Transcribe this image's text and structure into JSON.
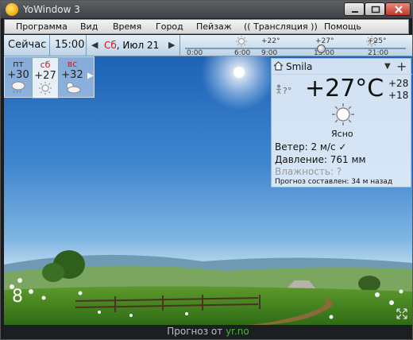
{
  "window": {
    "title": "YoWindow 3"
  },
  "menu": [
    "Программа",
    "Вид",
    "Время",
    "Город",
    "Пейзаж",
    "(( Трансляция ))",
    "Помощь"
  ],
  "timebar": {
    "now_label": "Сейчас",
    "time": "15:00",
    "date_dow": "Сб",
    "date_rest": ", Июл 21",
    "ticks": [
      "0:00",
      "6:00",
      "9:00",
      "15:00",
      "21:00"
    ],
    "temps": [
      "+22°",
      "+27°",
      "+25°"
    ]
  },
  "forecast": {
    "days": [
      {
        "name": "пт",
        "temp": "+30",
        "icon": "rain-cloud-icon"
      },
      {
        "name": "сб",
        "temp": "+27",
        "icon": "sun-icon"
      },
      {
        "name": "вс",
        "temp": "+32",
        "icon": "sun-cloud-icon"
      }
    ]
  },
  "weather": {
    "city": "Smila",
    "feels": "?°",
    "temp": "+27°C",
    "high": "+28",
    "low": "+18",
    "condition": "Ясно",
    "wind": "Ветер:  2 м/с ✓",
    "pressure": "Давление:  761 мм",
    "humidity": "Влажность:  ?",
    "updated": "Прогноз составлен:  34 м назад"
  },
  "clock_hour": "8",
  "status": {
    "prefix": "Прогноз от ",
    "link": "yr.no"
  }
}
